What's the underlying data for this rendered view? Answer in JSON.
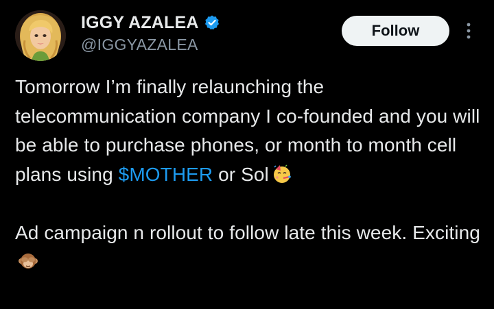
{
  "author": {
    "display_name": "IGGY AZALEA",
    "handle": "@IGGYAZALEA",
    "verified": true,
    "verified_icon": "verified-badge-icon",
    "avatar_icon": "avatar-illustration"
  },
  "actions": {
    "follow_label": "Follow",
    "more_icon": "more-options-icon"
  },
  "tweet": {
    "paragraph_1": {
      "text_before": "Tomorrow I’m finally relaunching the telecommunication company I co-founded and you will be able to purchase phones, or month to month cell plans using ",
      "cashtag": "$MOTHER",
      "text_after": " or Sol",
      "emoji": "partying-face-emoji"
    },
    "paragraph_2": {
      "text": "Ad campaign n rollout to follow late this week. Exciting",
      "emoji": "see-no-evil-monkey-emoji"
    }
  },
  "colors": {
    "background": "#000000",
    "text": "#e7e9ea",
    "secondary_text": "#8b98a5",
    "link": "#1d9bf0",
    "follow_bg": "#eff3f4",
    "verified": "#1d9bf0"
  }
}
